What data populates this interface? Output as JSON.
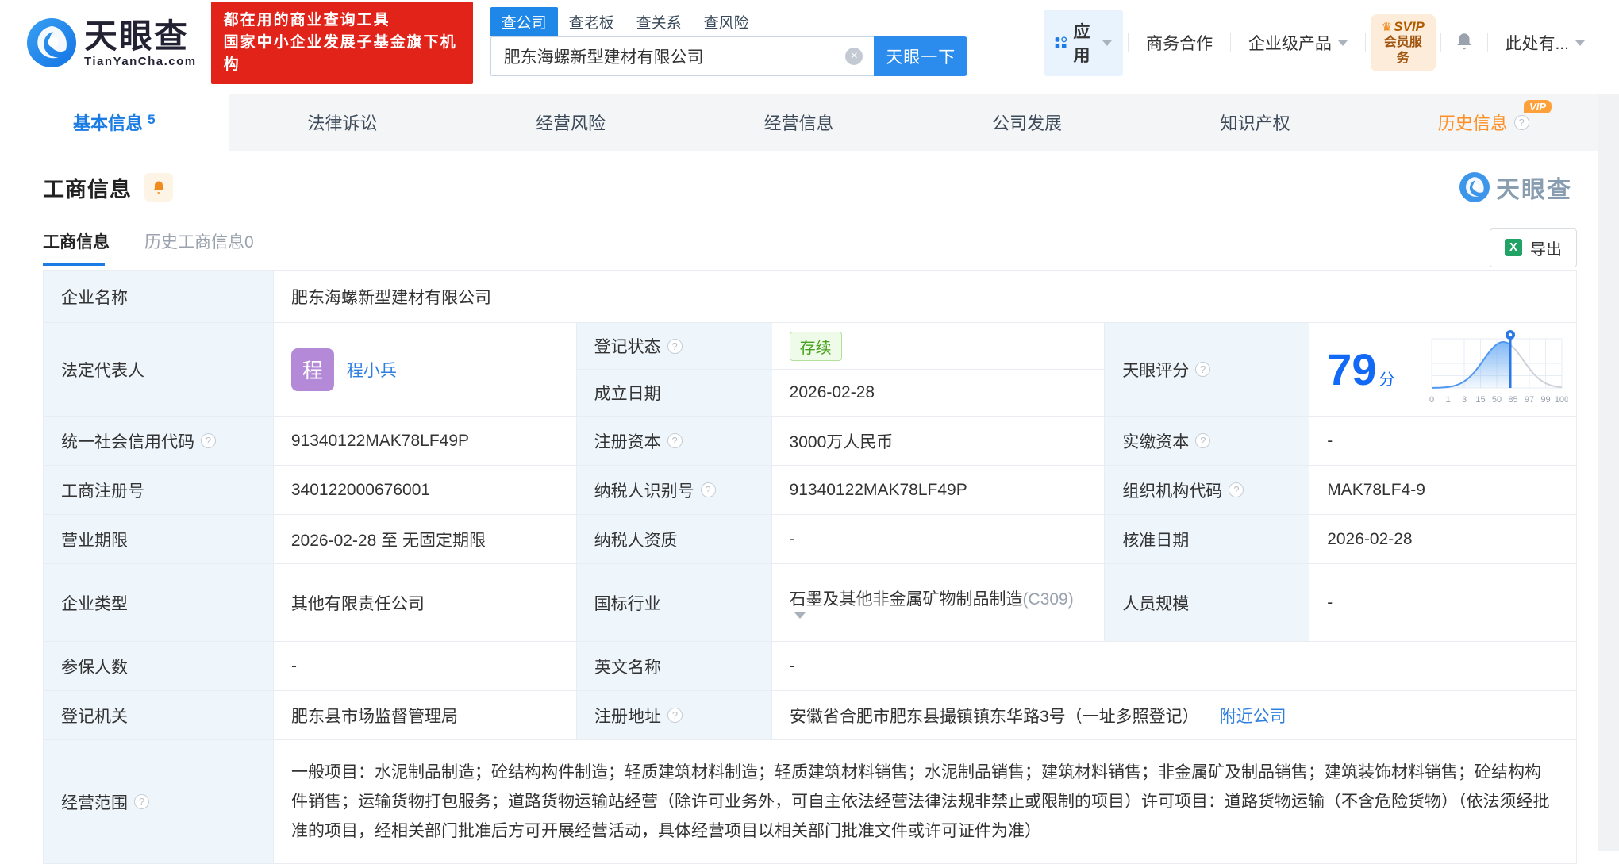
{
  "header": {
    "brand": {
      "name": "天眼查",
      "domain": "TianYanCha.com"
    },
    "promo": {
      "line1": "都在用的商业查询工具",
      "line2": "国家中小企业发展子基金旗下机构"
    },
    "search": {
      "tabs": [
        {
          "label": "查公司",
          "active": true
        },
        {
          "label": "查老板"
        },
        {
          "label": "查关系"
        },
        {
          "label": "查风险"
        }
      ],
      "value": "肥东海螺新型建材有限公司",
      "submit": "天眼一下"
    },
    "nav": {
      "apps": "应用",
      "cooperation": "商务合作",
      "enterprise": "企业级产品",
      "svip_top": "SVIP",
      "svip_bottom": "会员服务",
      "account": "此处有..."
    }
  },
  "tabs": {
    "items": [
      {
        "label": "基本信息",
        "count": "5",
        "active": true
      },
      {
        "label": "法律诉讼"
      },
      {
        "label": "经营风险"
      },
      {
        "label": "经营信息"
      },
      {
        "label": "公司发展"
      },
      {
        "label": "知识产权"
      },
      {
        "label": "历史信息",
        "vip": "VIP"
      }
    ]
  },
  "section": {
    "title": "工商信息",
    "watermark": "天眼查",
    "subtab_active": "工商信息",
    "subtab_history": "历史工商信息",
    "subtab_history_count": "0",
    "export": "导出"
  },
  "info": {
    "company_name_label": "企业名称",
    "company_name": "肥东海螺新型建材有限公司",
    "legal_rep_label": "法定代表人",
    "legal_rep_initial": "程",
    "legal_rep_name": "程小兵",
    "reg_status_label": "登记状态",
    "reg_status": "存续",
    "establish_label": "成立日期",
    "establish_date": "2026-02-28",
    "score_label": "天眼评分",
    "score": "79",
    "score_unit": "分",
    "credit_code_label": "统一社会信用代码",
    "credit_code": "91340122MAK78LF49P",
    "reg_capital_label": "注册资本",
    "reg_capital": "3000万人民币",
    "paid_capital_label": "实缴资本",
    "paid_capital": "-",
    "reg_number_label": "工商注册号",
    "reg_number": "340122000676001",
    "taxpayer_id_label": "纳税人识别号",
    "taxpayer_id": "91340122MAK78LF49P",
    "org_code_label": "组织机构代码",
    "org_code": "MAK78LF4-9",
    "term_label": "营业期限",
    "term": "2026-02-28 至 无固定期限",
    "taxpayer_quality_label": "纳税人资质",
    "taxpayer_quality": "-",
    "approve_date_label": "核准日期",
    "approve_date": "2026-02-28",
    "company_type_label": "企业类型",
    "company_type": "其他有限责任公司",
    "industry_label": "国标行业",
    "industry": "石墨及其他非金属矿物制品制造",
    "industry_code": "(C309)",
    "staff_size_label": "人员规模",
    "staff_size": "-",
    "insured_label": "参保人数",
    "insured": "-",
    "english_name_label": "英文名称",
    "english_name": "-",
    "authority_label": "登记机关",
    "authority": "肥东县市场监督管理局",
    "address_label": "注册地址",
    "address": "安徽省合肥市肥东县撮镇镇东华路3号（一址多照登记）",
    "nearby_link": "附近公司",
    "scope_label": "经营范围",
    "scope": "一般项目：水泥制品制造；砼结构构件制造；轻质建筑材料制造；轻质建筑材料销售；水泥制品销售；建筑材料销售；非金属矿及制品销售；建筑装饰材料销售；砼结构构件销售；运输货物打包服务；道路货物运输站经营（除许可业务外，可自主依法经营法律法规非禁止或限制的项目）许可项目：道路货物运输（不含危险货物）（依法须经批准的项目，经相关部门批准后方可开展经营活动，具体经营项目以相关部门批准文件或许可证件为准）"
  },
  "chart_data": {
    "type": "area",
    "title": "天眼评分分布曲线",
    "score": 79,
    "score_unit": "分",
    "x_ticks": [
      "0",
      "1",
      "3",
      "15",
      "50",
      "85",
      "97",
      "99",
      "100"
    ],
    "marker_tick_index": 4.83,
    "peak_tick_index": 4.4,
    "sigma": 1.22,
    "fill_top_color": "#7ab4f5",
    "line_color": "#4f97f0",
    "rest_color": "#cdd2d9",
    "marker_color": "#2b77e5",
    "grid_color": "#e6edf5",
    "tick_color": "#97a1ae",
    "grid": true
  },
  "colors": {
    "primary_blue": "#1b7ce4",
    "banner_red": "#e2231a",
    "status_green": "#47a11d",
    "vip_orange": "#ffa13a",
    "label_cell_bg": "#eef6fc"
  }
}
